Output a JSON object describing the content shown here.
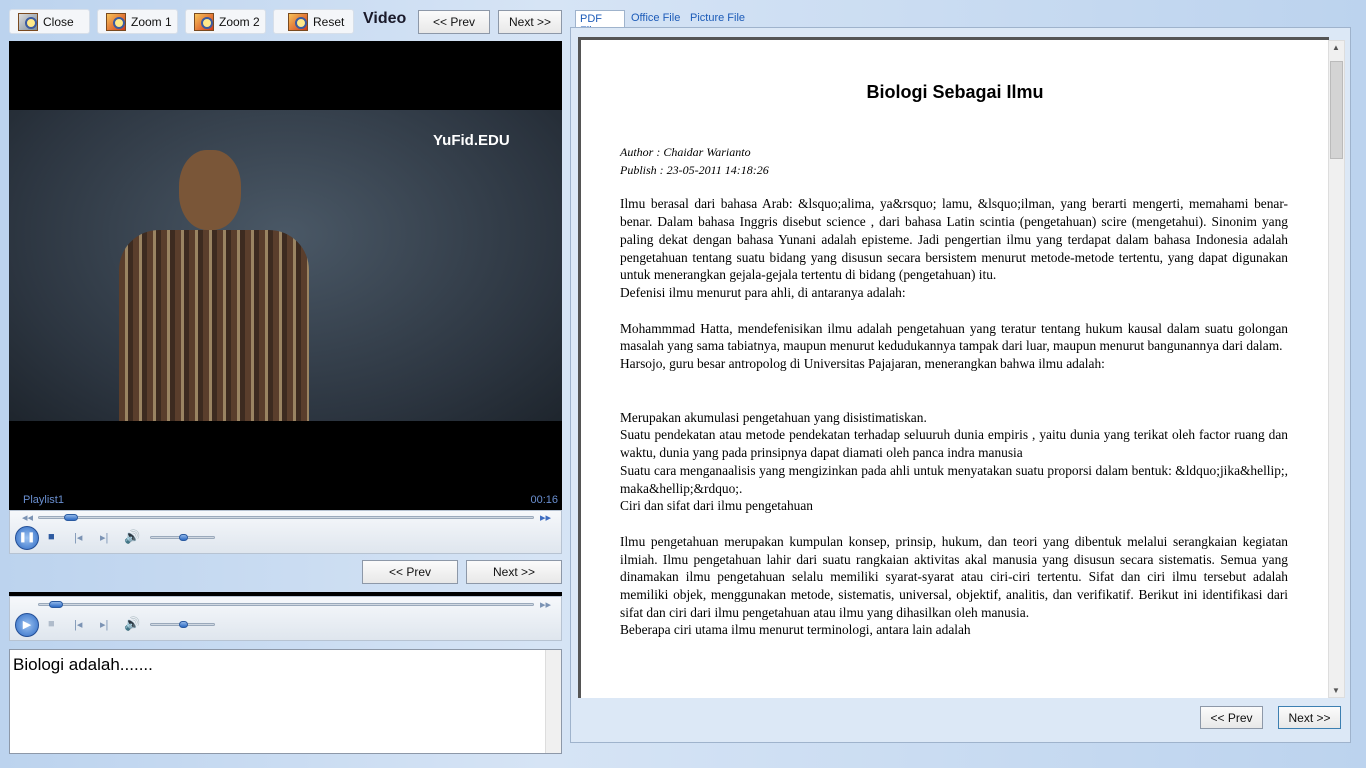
{
  "toolbar": {
    "close": "Close",
    "zoom1": "Zoom 1",
    "zoom2": "Zoom 2",
    "reset": "Reset",
    "section_title": "Video",
    "prev": "<< Prev",
    "next": "Next >>"
  },
  "video": {
    "watermark": "YuFid.EDU",
    "playlist": "Playlist1",
    "time": "00:16",
    "progress": 0.05,
    "volume": 0.5
  },
  "mid_nav": {
    "prev": "<< Prev",
    "next": "Next >>"
  },
  "audio": {
    "progress": 0.02,
    "volume": 0.5
  },
  "notes": {
    "text": "Biologi adalah......."
  },
  "tabs": [
    {
      "label": "PDF File",
      "active": true
    },
    {
      "label": "Office File"
    },
    {
      "label": "Picture File"
    }
  ],
  "doc": {
    "title": "Biologi Sebagai Ilmu",
    "author": "Author : Chaidar Warianto",
    "publish": "Publish : 23-05-2011 14:18:26",
    "paragraphs": [
      "Ilmu berasal dari bahasa Arab: &lsquo;alima, ya&rsquo; lamu, &lsquo;ilman, yang berarti mengerti, memahami benar-benar. Dalam bahasa Inggris disebut science , dari bahasa Latin scintia (pengetahuan) scire (mengetahui). Sinonim yang paling dekat dengan bahasa Yunani adalah episteme. Jadi pengertian ilmu yang terdapat dalam bahasa Indonesia  adalah pengetahuan tentang suatu bidang yang disusun secara bersistem menurut metode-metode tertentu, yang dapat digunakan untuk menerangkan gejala-gejala tertentu di bidang (pengetahuan) itu.",
      " Defenisi ilmu menurut para ahli, di antaranya adalah:",
      "Mohammmad Hatta, mendefenisikan ilmu adalah pengetahuan yang teratur tentang hukum kausal dalam suatu golongan masalah yang sama tabiatnya, maupun menurut kedudukannya tampak dari luar, maupun menurut bangunannya dari dalam.",
      "Harsojo, guru besar antropolog di Universitas Pajajaran, menerangkan bahwa ilmu adalah:",
      "Merupakan akumulasi pengetahuan yang disistimatiskan.",
      "Suatu pendekatan atau metode pendekatan terhadap seluuruh dunia empiris , yaitu dunia yang terikat oleh factor ruang dan waktu, dunia yang pada prinsipnya dapat diamati oleh panca indra manusia",
      "Suatu cara menganaalisis yang mengizinkan pada ahli untuk menyatakan suatu proporsi dalam bentuk: &ldquo;jika&hellip;, maka&hellip;&rdquo;.",
      "Ciri dan sifat dari ilmu pengetahuan",
      "Ilmu pengetahuan merupakan kumpulan konsep, prinsip, hukum, dan teori yang dibentuk melalui serangkaian kegiatan ilmiah. Ilmu pengetahuan lahir dari suatu rangkaian aktivitas akal manusia yang disusun secara sistematis. Semua yang dinamakan ilmu pengetahuan selalu memiliki syarat-syarat atau ciri-ciri tertentu. Sifat dan ciri ilmu tersebut adalah memiliki objek, menggunakan metode, sistematis, universal, objektif, analitis, dan verifikatif. Berikut ini identifikasi dari sifat dan ciri dari ilmu pengetahuan atau ilmu yang dihasilkan oleh manusia.",
      "Beberapa ciri utama ilmu menurut terminologi, antara lain adalah"
    ]
  },
  "doc_nav": {
    "prev": "<< Prev",
    "next": "Next >>"
  },
  "colors": {
    "accent": "#2d6ac4",
    "background": "#c5d9f1"
  }
}
